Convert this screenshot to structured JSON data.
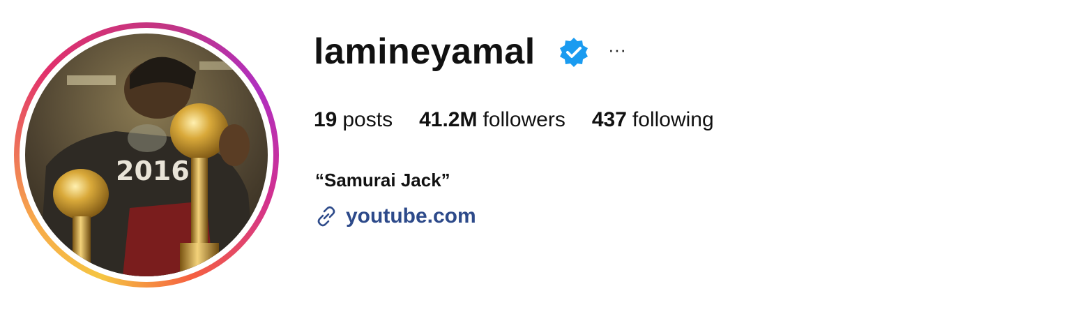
{
  "profile": {
    "username": "lamineyamal",
    "verified_icon": "verified-badge-icon",
    "more_icon": "more-options-icon",
    "more_glyph": "···",
    "avatar_icon": "profile-photo",
    "bio": "“Samurai Jack”"
  },
  "stats": [
    {
      "value": "19",
      "label": "posts"
    },
    {
      "value": "41.2M",
      "label": "followers"
    },
    {
      "value": "437",
      "label": "following"
    }
  ],
  "link": {
    "icon": "link-icon",
    "text": "youtube.com"
  },
  "colors": {
    "text": "#111111",
    "link": "#2d4a8a",
    "verified": "#1a9bf0",
    "ring_gradient": [
      "#f5c542",
      "#e1306c",
      "#b02fc0"
    ]
  }
}
